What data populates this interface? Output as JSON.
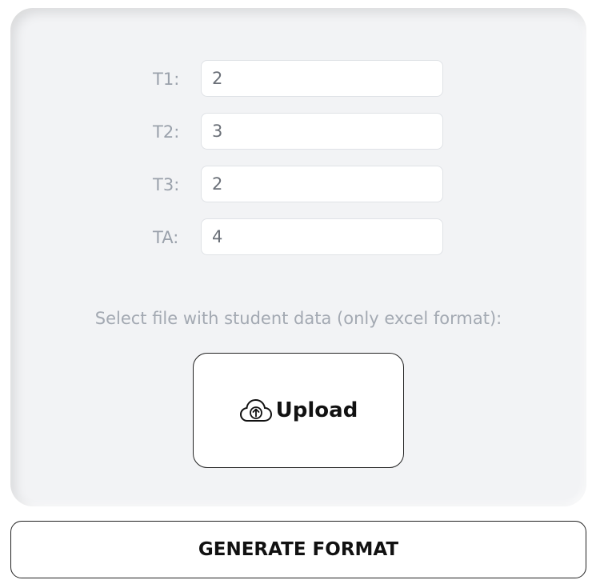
{
  "fields": [
    {
      "label": "T1:",
      "value": "2"
    },
    {
      "label": "T2:",
      "value": "3"
    },
    {
      "label": "T3:",
      "value": "2"
    },
    {
      "label": "TA:",
      "value": "4"
    }
  ],
  "upload": {
    "hint": "Select file with student data (only excel format):",
    "button_label": "Upload",
    "icon": "cloud-upload-icon"
  },
  "actions": {
    "generate_label": "GENERATE FORMAT"
  },
  "colors": {
    "panel_bg": "#f2f3f5",
    "label_text": "#9aa1ab",
    "input_text": "#6b7078",
    "border_dark": "#222222"
  }
}
